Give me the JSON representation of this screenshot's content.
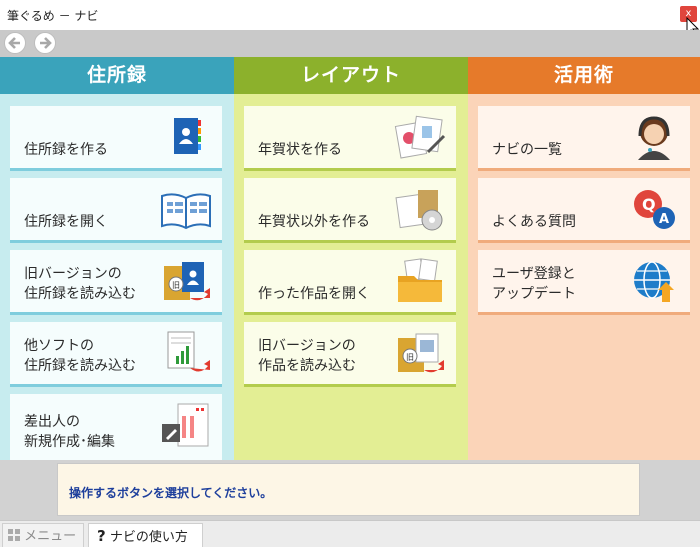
{
  "window": {
    "title": "筆ぐるめ － ナビ",
    "close_label": "x"
  },
  "columns": [
    {
      "title": "住所録",
      "buttons": [
        {
          "label": "住所録を作る",
          "icon": "address-book-icon"
        },
        {
          "label": "住所録を開く",
          "icon": "open-book-icon"
        },
        {
          "label": "旧バージョンの\n住所録を読み込む",
          "icon": "import-old-addressbook-icon"
        },
        {
          "label": "他ソフトの\n住所録を読み込む",
          "icon": "import-other-software-icon"
        },
        {
          "label": "差出人の\n新規作成･編集",
          "icon": "sender-edit-icon"
        }
      ]
    },
    {
      "title": "レイアウト",
      "buttons": [
        {
          "label": "年賀状を作る",
          "icon": "new-year-card-icon"
        },
        {
          "label": "年賀状以外を作る",
          "icon": "other-cards-icon"
        },
        {
          "label": "作った作品を開く",
          "icon": "open-folder-icon"
        },
        {
          "label": "旧バージョンの\n作品を読み込む",
          "icon": "import-old-work-icon"
        }
      ]
    },
    {
      "title": "活用術",
      "buttons": [
        {
          "label": "ナビの一覧",
          "icon": "operator-icon"
        },
        {
          "label": "よくある質問",
          "icon": "qa-icon"
        },
        {
          "label": "ユーザ登録と\nアップデート",
          "icon": "globe-update-icon"
        }
      ]
    }
  ],
  "info": {
    "message": "操作するボタンを選択してください。"
  },
  "bottom_tabs": {
    "menu": "メニュー",
    "help": "ナビの使い方",
    "help_mark": "?"
  },
  "colors": {
    "col1_head": "#3aa3bb",
    "col2_head": "#8cb12c",
    "col3_head": "#e67a2a"
  }
}
